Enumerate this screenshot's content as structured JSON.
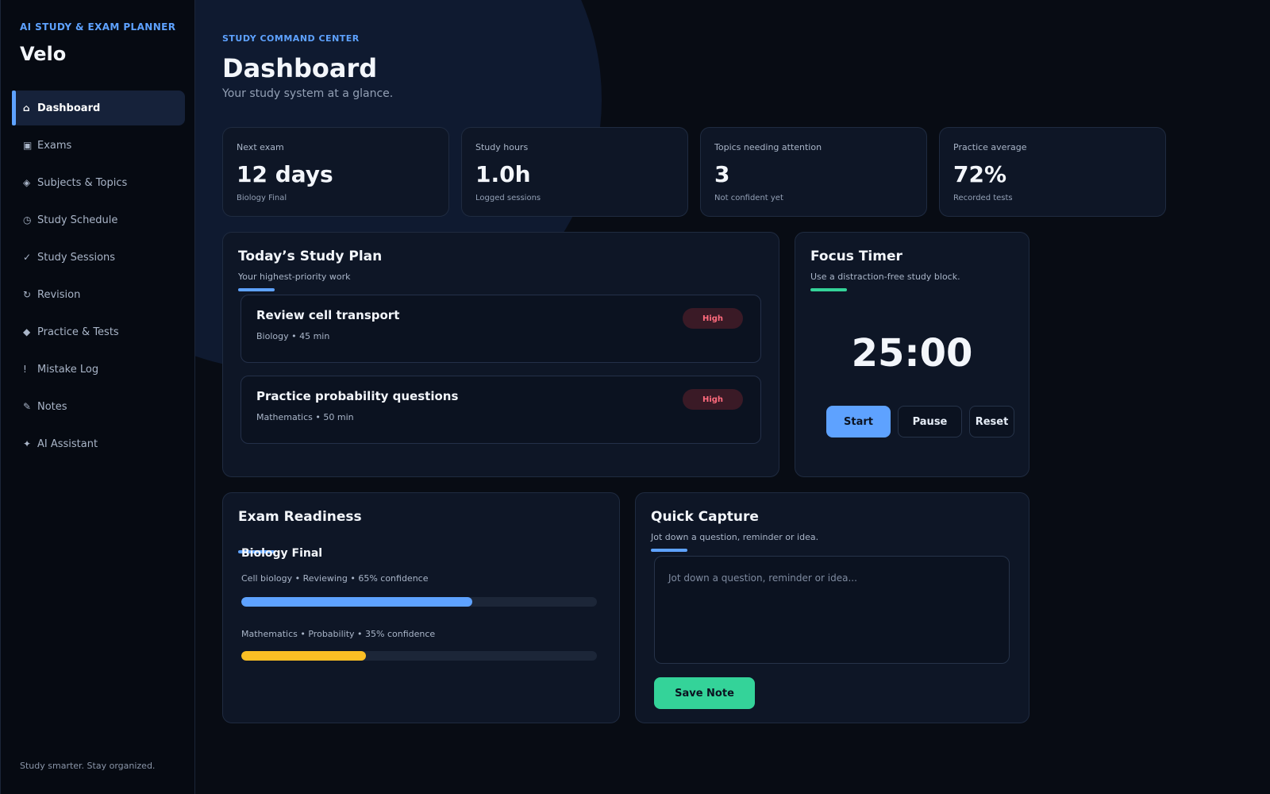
{
  "brand": {
    "kicker": "AI STUDY & EXAM PLANNER",
    "name": "Velo"
  },
  "nav": {
    "items": [
      {
        "icon": "⌂",
        "label": "Dashboard"
      },
      {
        "icon": "▣",
        "label": "Exams"
      },
      {
        "icon": "◈",
        "label": "Subjects & Topics"
      },
      {
        "icon": "◷",
        "label": "Study Schedule"
      },
      {
        "icon": "✓",
        "label": "Study Sessions"
      },
      {
        "icon": "↻",
        "label": "Revision"
      },
      {
        "icon": "◆",
        "label": "Practice & Tests"
      },
      {
        "icon": "!",
        "label": "Mistake Log"
      },
      {
        "icon": "✎",
        "label": "Notes"
      },
      {
        "icon": "✦",
        "label": "AI Assistant"
      }
    ],
    "active": "Dashboard"
  },
  "sidebar_footer": "Study smarter. Stay organized.",
  "header": {
    "kicker": "STUDY COMMAND CENTER",
    "title": "Dashboard",
    "subtitle": "Your study system at a glance."
  },
  "stats": [
    {
      "label": "Next exam",
      "value": "12 days",
      "sub": "Biology Final"
    },
    {
      "label": "Study hours",
      "value": "1.0h",
      "sub": "Logged sessions"
    },
    {
      "label": "Topics needing attention",
      "value": "3",
      "sub": "Not confident yet"
    },
    {
      "label": "Practice average",
      "value": "72%",
      "sub": "Recorded tests"
    }
  ],
  "plan": {
    "title": "Today’s Study Plan",
    "subtitle": "Your highest-priority work",
    "tasks": [
      {
        "title": "Review cell transport",
        "meta": "Biology • 45 min",
        "priority": "High"
      },
      {
        "title": "Practice probability questions",
        "meta": "Mathematics • 50 min",
        "priority": "High"
      }
    ]
  },
  "timer": {
    "title": "Focus Timer",
    "subtitle": "Use a distraction-free study block.",
    "value": "25:00",
    "start_label": "Start",
    "pause_label": "Pause",
    "reset_label": "Reset"
  },
  "readiness": {
    "title": "Exam Readiness",
    "exam": "Biology Final",
    "topics": [
      {
        "label": "Cell biology • Reviewing • 65% confidence",
        "confidence": 0.65,
        "color": "#5ea2ff"
      },
      {
        "label": "Mathematics • Probability • 35% confidence",
        "confidence": 0.35,
        "color": "#fbbf24"
      }
    ]
  },
  "capture": {
    "title": "Quick Capture",
    "subtitle": "Jot down a question, reminder or idea.",
    "placeholder": "Jot down a question, reminder or idea...",
    "value": "",
    "save_label": "Save Note"
  },
  "colors": {
    "accent": "#5ea2ff",
    "success": "#34d399",
    "warning": "#fbbf24",
    "danger": "#ff6b7d",
    "background": "#080c14",
    "card": "#0e1626"
  }
}
